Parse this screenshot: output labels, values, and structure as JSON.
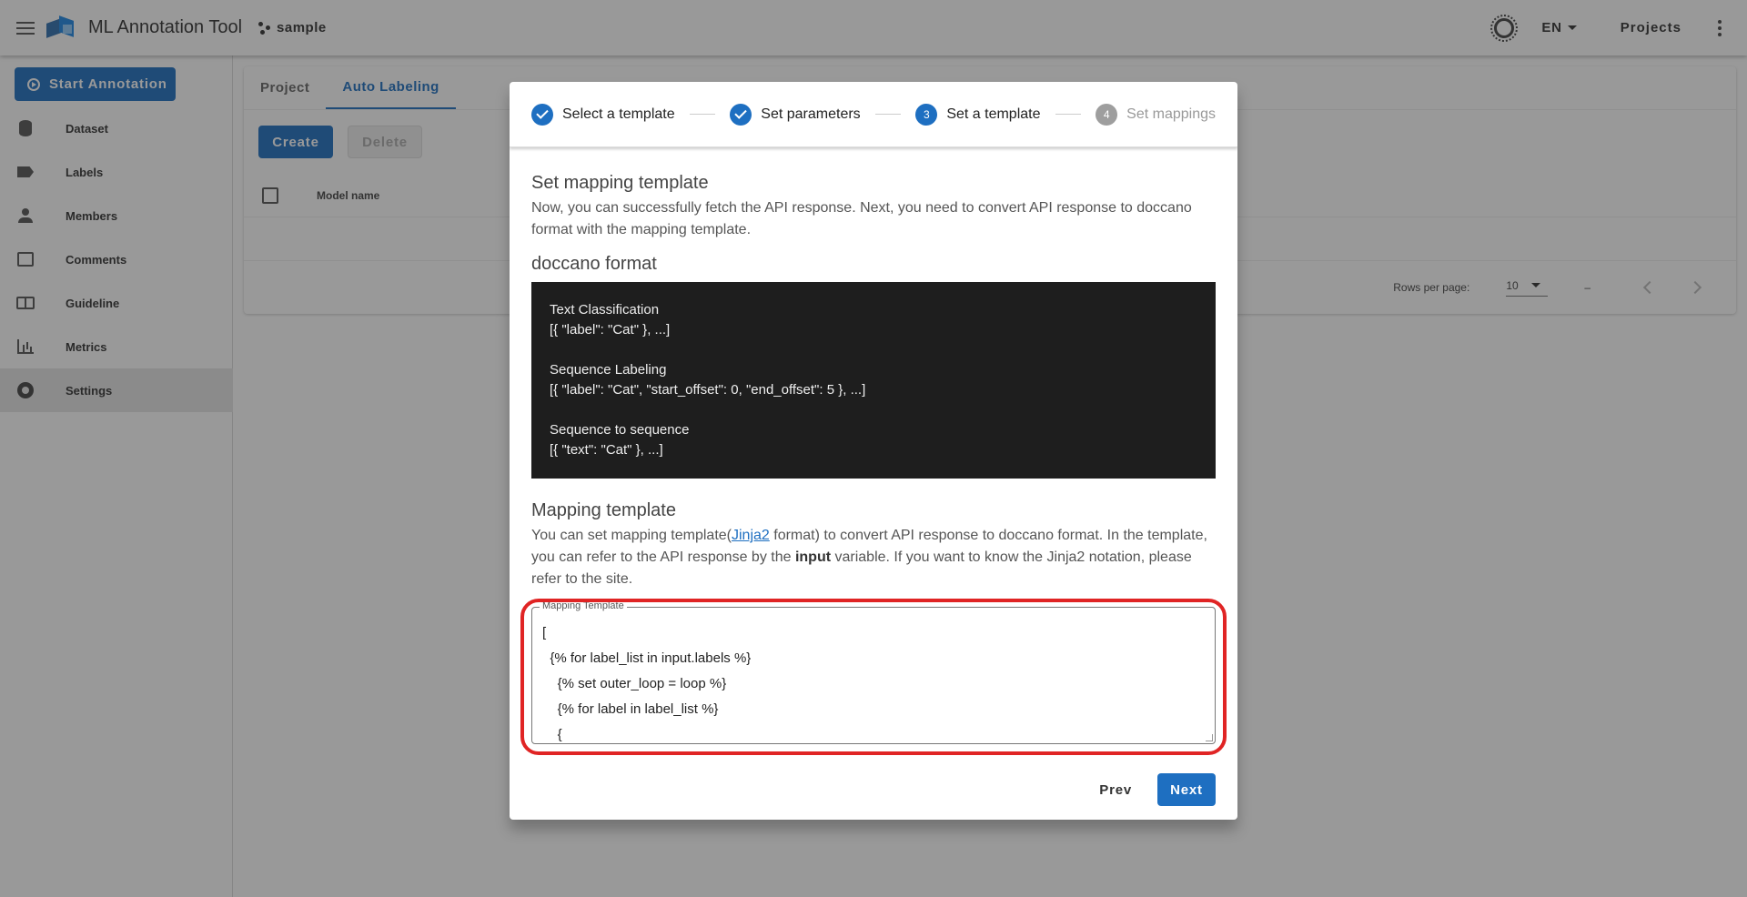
{
  "appbar": {
    "title": "ML Annotation Tool",
    "project_name": "sample",
    "language": "EN",
    "projects_label": "Projects"
  },
  "sidebar": {
    "start_label": "Start Annotation",
    "items": [
      {
        "label": "Dataset",
        "icon": "database-icon"
      },
      {
        "label": "Labels",
        "icon": "label-icon"
      },
      {
        "label": "Members",
        "icon": "person-icon"
      },
      {
        "label": "Comments",
        "icon": "comment-icon"
      },
      {
        "label": "Guideline",
        "icon": "book-icon"
      },
      {
        "label": "Metrics",
        "icon": "chart-icon"
      },
      {
        "label": "Settings",
        "icon": "gear-icon",
        "active": true
      }
    ]
  },
  "main": {
    "tabs": [
      "Project",
      "Auto Labeling"
    ],
    "active_tab": "Auto Labeling",
    "create_label": "Create",
    "delete_label": "Delete",
    "table_header": "Model name",
    "rows_per_page_label": "Rows per page:",
    "rows_per_page_value": "10",
    "page_range": "–"
  },
  "dialog": {
    "steps": [
      {
        "label": "Select a template",
        "state": "complete"
      },
      {
        "label": "Set parameters",
        "state": "complete"
      },
      {
        "label": "Set a template",
        "state": "active",
        "number": "3"
      },
      {
        "label": "Set mappings",
        "state": "disabled",
        "number": "4"
      }
    ],
    "title": "Set mapping template",
    "intro": "Now, you can successfully fetch the API response. Next, you need to convert API response to doccano format with the mapping template.",
    "format_title": "doccano format",
    "format_lines": {
      "tc_title": "Text Classification",
      "tc_example": "[{ \"label\": \"Cat\" }, ...]",
      "sl_title": "Sequence Labeling",
      "sl_example": "[{ \"label\": \"Cat\", \"start_offset\": 0, \"end_offset\": 5 }, ...]",
      "s2s_title": "Sequence to sequence",
      "s2s_example": "[{ \"text\": \"Cat\" }, ...]"
    },
    "mapping_title": "Mapping template",
    "mapping_desc_1": "You can set mapping template(",
    "mapping_link": "Jinja2",
    "mapping_desc_2": " format) to convert API response to doccano format. In the template, you can refer to the API response by the ",
    "mapping_bold": "input",
    "mapping_desc_3": " variable. If you want to know the Jinja2 notation, please refer to the site.",
    "textarea_label": "Mapping Template",
    "textarea_value": "[\n  {% for label_list in input.labels %}\n    {% set outer_loop = loop %}\n    {% for label in label_list %}\n    {",
    "prev_label": "Prev",
    "next_label": "Next"
  },
  "colors": {
    "primary": "#1e6fc1",
    "highlight": "#e02424"
  }
}
